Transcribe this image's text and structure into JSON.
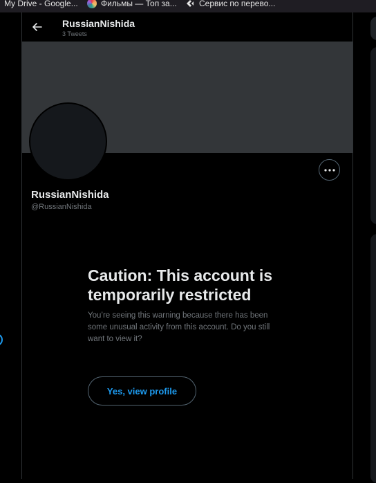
{
  "bookmarks": [
    {
      "label": "My Drive - Google...",
      "icon": "google-drive-icon"
    },
    {
      "label": "Фильмы — Топ за...",
      "icon": "color-wheel-icon"
    },
    {
      "label": "Сервис по перево...",
      "icon": "translate-icon"
    }
  ],
  "header": {
    "name": "RussianNishida",
    "tweet_count": "3 Tweets"
  },
  "profile": {
    "name": "RussianNishida",
    "handle": "@RussianNishida"
  },
  "caution": {
    "title": "Caution: This account is temporarily restricted",
    "body": "You’re seeing this warning because there has been some unusual activity from this account. Do you still want to view it?",
    "button_label": "Yes, view profile"
  },
  "colors": {
    "background": "#000000",
    "banner": "#333639",
    "accent": "#1d9bf0",
    "secondary_text": "#71767b"
  }
}
